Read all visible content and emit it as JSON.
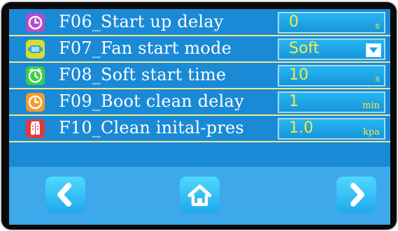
{
  "settings": [
    {
      "code_label": "F06_Start up delay",
      "value": "0",
      "unit": "s",
      "icon": "clock-icon",
      "icon_color": "#b24cc7"
    },
    {
      "code_label": "F07_Fan start mode",
      "value": "Soft",
      "unit": "",
      "icon": "fan-icon",
      "icon_color": "#d8dd2a",
      "dropdown": true
    },
    {
      "code_label": "F08_Soft start time",
      "value": "10",
      "unit": "s",
      "icon": "timer-icon",
      "icon_color": "#3dcf44"
    },
    {
      "code_label": "F09_Boot clean delay",
      "value": "1",
      "unit": "min",
      "icon": "clock-icon",
      "icon_color": "#f39a2c"
    },
    {
      "code_label": "F10_Clean inital-pres",
      "value": "1.0",
      "unit": "kpa",
      "icon": "gauge-icon",
      "icon_color": "#e23a3a"
    }
  ],
  "nav": {
    "back": "chevron-left-icon",
    "home": "home-icon",
    "next": "chevron-right-icon"
  },
  "colors": {
    "background": "#1a8ad6",
    "value_text": "#f6e94a",
    "divider": "#f0e88a",
    "nav_button": "#2fc3f5"
  }
}
